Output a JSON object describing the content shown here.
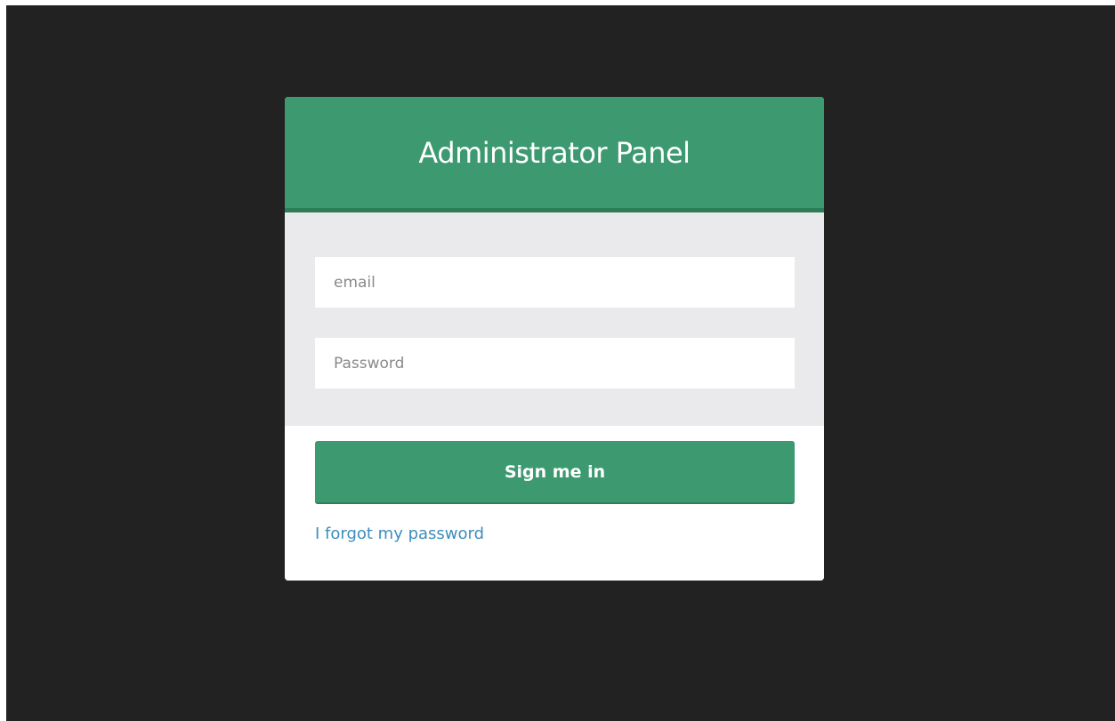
{
  "header": {
    "title": "Administrator Panel"
  },
  "form": {
    "email_placeholder": "email",
    "email_value": "",
    "password_placeholder": "Password",
    "password_value": "",
    "submit_label": "Sign me in",
    "forgot_label": "I forgot my password"
  },
  "colors": {
    "background": "#222222",
    "accent": "#3d9970",
    "form_body": "#eaeaec",
    "link": "#3c8dbc"
  }
}
